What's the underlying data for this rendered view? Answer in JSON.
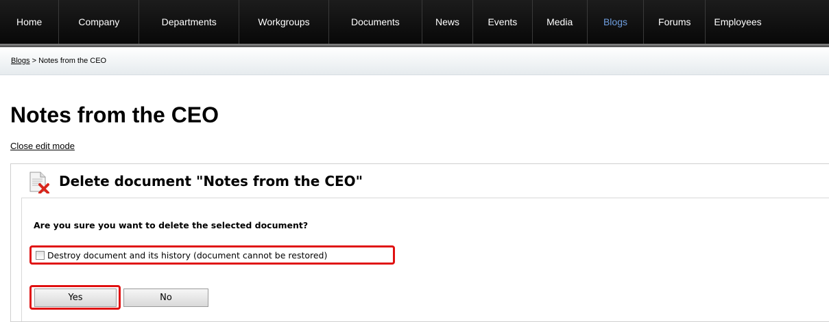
{
  "nav": {
    "items": [
      {
        "label": "Home",
        "active": false
      },
      {
        "label": "Company",
        "active": false
      },
      {
        "label": "Departments",
        "active": false
      },
      {
        "label": "Workgroups",
        "active": false
      },
      {
        "label": "Documents",
        "active": false
      },
      {
        "label": "News",
        "active": false
      },
      {
        "label": "Events",
        "active": false
      },
      {
        "label": "Media",
        "active": false
      },
      {
        "label": "Blogs",
        "active": true
      },
      {
        "label": "Forums",
        "active": false
      },
      {
        "label": "Employees",
        "active": false
      }
    ],
    "active_color": "#6f9fe0"
  },
  "breadcrumb": {
    "link": "Blogs",
    "separator": " > ",
    "current": "Notes from the CEO"
  },
  "page": {
    "title": "Notes from the CEO",
    "close_edit_mode": "Close edit mode"
  },
  "dialog": {
    "title": "Delete document \"Notes from the CEO\"",
    "question": "Are you sure you want to delete the selected document?",
    "destroy_label": "Destroy document and its history (document cannot be restored)",
    "destroy_checked": false,
    "yes_label": "Yes",
    "no_label": "No",
    "highlight_color": "#e01010"
  },
  "icons": {
    "dialog_icon": "delete-document-icon"
  }
}
